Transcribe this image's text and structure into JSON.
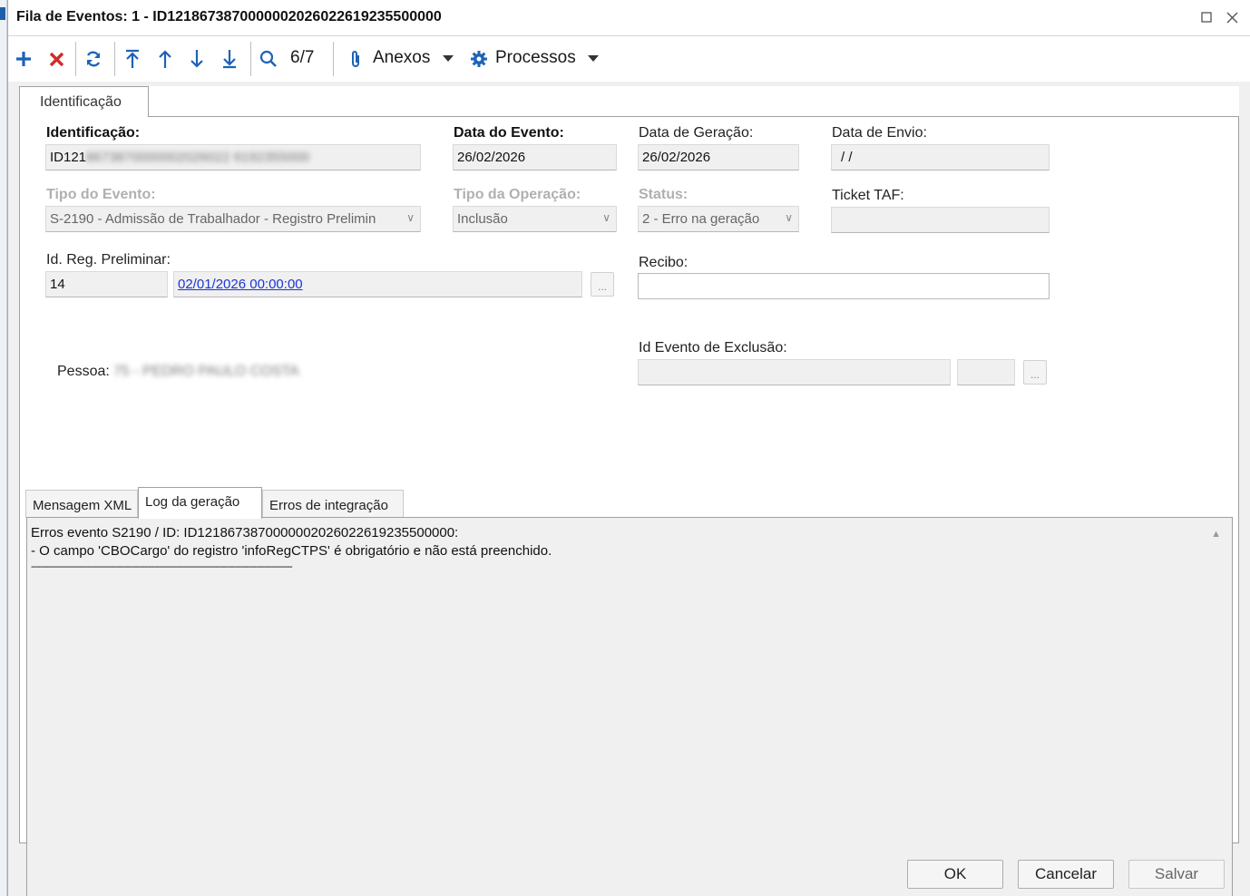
{
  "window": {
    "title": "Fila de Eventos: 1 - ID1218673870000002026022619235500000"
  },
  "toolbar": {
    "add_icon": "plus-icon",
    "delete_icon": "x-icon",
    "refresh_icon": "refresh-icon",
    "first_icon": "arrow-to-top-icon",
    "prev_icon": "arrow-up-icon",
    "next_icon": "arrow-down-icon",
    "last_icon": "arrow-to-bottom-icon",
    "search_icon": "magnifier-icon",
    "record_counter": "6/7",
    "attachments_label": "Anexos",
    "processes_label": "Processos"
  },
  "tabs": {
    "main": "Identificação",
    "inner": [
      "Mensagem XML",
      "Log da geração",
      "Erros de integração"
    ],
    "active_inner": "Log da geração"
  },
  "form": {
    "identificacao_label": "Identificação:",
    "identificacao_value_visible": "ID121",
    "identificacao_value_obscured": "8673870000002026022 6192355000",
    "data_evento_label": "Data do Evento:",
    "data_evento_value": "26/02/2026",
    "data_geracao_label": "Data de Geração:",
    "data_geracao_value": "26/02/2026",
    "data_envio_label": "Data de Envio:",
    "data_envio_value": " / /",
    "tipo_evento_label": "Tipo do Evento:",
    "tipo_evento_value": "S-2190 - Admissão de Trabalhador - Registro Prelimin",
    "tipo_operacao_label": "Tipo da Operação:",
    "tipo_operacao_value": "Inclusão",
    "status_label": "Status:",
    "status_value": "2 - Erro na geração",
    "ticket_label": "Ticket TAF:",
    "ticket_value": "",
    "id_reg_label": "Id. Reg. Preliminar:",
    "id_reg_value": "14",
    "id_reg_link": "02/01/2026 00:00:00",
    "recibo_label": "Recibo:",
    "recibo_value": "",
    "pessoa_label": "Pessoa:",
    "pessoa_value_obscured": "75 - PEDRO PAULO COSTA",
    "id_exclusao_label": "Id Evento de Exclusão:",
    "ellipsis": "..."
  },
  "log": {
    "lines": [
      "Erros evento S2190 / ID: ID1218673870000002026022619235500000:",
      "- O campo 'CBOCargo' do registro 'infoRegCTPS' é obrigatório e não está preenchido.",
      "------------------------------------------------------------------------------------------------------------"
    ]
  },
  "footer": {
    "ok": "OK",
    "cancel": "Cancelar",
    "save": "Salvar"
  },
  "colors": {
    "accent_blue": "#1e63b5",
    "delete_red": "#d22b2b",
    "link_blue": "#1a35d6"
  }
}
